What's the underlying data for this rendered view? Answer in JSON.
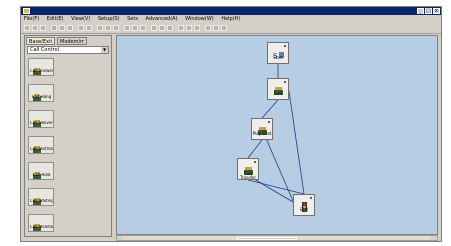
{
  "window": {
    "title": "",
    "minimize_glyph": "_",
    "maximize_glyph": "□",
    "close_glyph": "x"
  },
  "menu": [
    "File(F)",
    "Edit(E)",
    "View(V)",
    "Setup(S)",
    "Sets",
    "Advanced(A)",
    "Window(W)",
    "Help(H)"
  ],
  "palette": {
    "tabs": [
      "Base/Exit",
      "Modem/rr"
    ],
    "selected_group": "Call Control",
    "items": [
      {
        "label": "Call Answer",
        "icon": "phone-icon"
      },
      {
        "label": "Call Hang",
        "icon": "phone-icon"
      },
      {
        "label": "Call Delivery",
        "icon": "phone-icon"
      },
      {
        "label": "Call Distribution",
        "icon": "keypad-icon"
      },
      {
        "label": "Call Hold",
        "icon": "phone-icon"
      },
      {
        "label": "Call Waiting",
        "icon": "phone-icon"
      },
      {
        "label": "Call Monitor",
        "icon": "phone-icon"
      }
    ]
  },
  "canvas": {
    "background": "#b7cde4",
    "nodes": [
      {
        "id": "start",
        "label": "Start",
        "icon": "start-icon"
      },
      {
        "id": "call1",
        "label": "Call",
        "icon": "phone-icon"
      },
      {
        "id": "play",
        "label": "Play Cmd",
        "icon": "keypad-icon"
      },
      {
        "id": "call2",
        "label": "Call Transfer",
        "icon": "phone-icon"
      },
      {
        "id": "end",
        "label": "End",
        "icon": "traffic-light-icon"
      }
    ]
  },
  "colors": {
    "titlebar": "#0a246a",
    "connector": "#1e3a8a",
    "accent_red": "#cc2020"
  }
}
